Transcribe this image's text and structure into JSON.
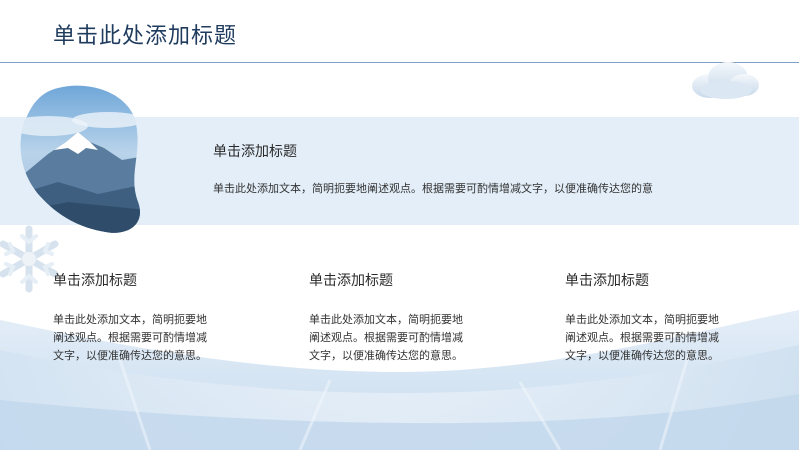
{
  "slide": {
    "title": "单击此处添加标题"
  },
  "feature": {
    "title": "单击添加标题",
    "text": "单击此处添加文本，简明扼要地阐述观点。根据需要可酌情增减文字，以便准确传达您的意"
  },
  "columns": [
    {
      "title": "单击添加标题",
      "text": "单击此处添加文本，简明扼要地阐述观点。根据需要可酌情增减文字，以便准确传达您的意思。"
    },
    {
      "title": "单击添加标题",
      "text": "单击此处添加文本，简明扼要地阐述观点。根据需要可酌情增减文字，以便准确传达您的意思。"
    },
    {
      "title": "单击添加标题",
      "text": "单击此处添加文本，简明扼要地阐述观点。根据需要可酌情增减文字，以便准确传达您的意思。"
    }
  ],
  "colors": {
    "title": "#1f3b5e",
    "band": "#e3eef8",
    "accent": "#7d9fc4"
  }
}
